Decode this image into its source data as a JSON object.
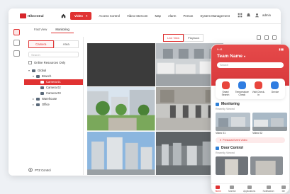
{
  "brand": "HikCentral",
  "nav": {
    "items": [
      {
        "label": "Video",
        "active": true
      },
      {
        "label": "Access Control"
      },
      {
        "label": "Video Intercom"
      },
      {
        "label": "Map"
      },
      {
        "label": "Alarm"
      },
      {
        "label": "Person"
      },
      {
        "label": "System Management"
      }
    ],
    "close_glyph": "×",
    "user": "admin"
  },
  "subtabs": [
    "Fast View",
    "Monitoring"
  ],
  "tree": {
    "tabs": [
      "Camera",
      "Area"
    ],
    "search_placeholder": "Search",
    "online_only": "Online Resources Only",
    "nodes": [
      {
        "label": "Global",
        "caret": "▾",
        "indent": 0
      },
      {
        "label": "Branch",
        "caret": "▾",
        "indent": 1
      },
      {
        "label": "Camera 01",
        "caret": "",
        "indent": 2,
        "selected": true
      },
      {
        "label": "Camera 02",
        "caret": "",
        "indent": 2
      },
      {
        "label": "Camera 03",
        "caret": "",
        "indent": 2
      },
      {
        "label": "Warehouse",
        "caret": "▸",
        "indent": 1
      },
      {
        "label": "Office",
        "caret": "▸",
        "indent": 1
      }
    ],
    "ptz": "PTZ Control"
  },
  "viewbar": {
    "tabs": [
      "Live View",
      "Playback"
    ]
  },
  "phone": {
    "time": "9:41",
    "team": "Team Name",
    "search_placeholder": "Search",
    "quick": [
      {
        "label": "Smart Search",
        "color": "#e8453c"
      },
      {
        "label": "Temperature Check",
        "color": "#2f7de1"
      },
      {
        "label": "Visit Check-in",
        "color": "#e8453c"
      },
      {
        "label": "Device",
        "color": "#2f7de1"
      }
    ],
    "monitoring": {
      "title": "Monitoring",
      "sub": "Recently Viewed",
      "cams": [
        "Video 01",
        "Video 02"
      ],
      "button": "Personal Event Video"
    },
    "door": {
      "title": "Door Control",
      "sub": "Recently Viewed"
    },
    "tabbar": [
      "Home",
      "Monitor",
      "Applications",
      "Notification",
      "Me"
    ]
  },
  "colors": {
    "accent": "#e03232",
    "blue": "#2e7fd6"
  }
}
